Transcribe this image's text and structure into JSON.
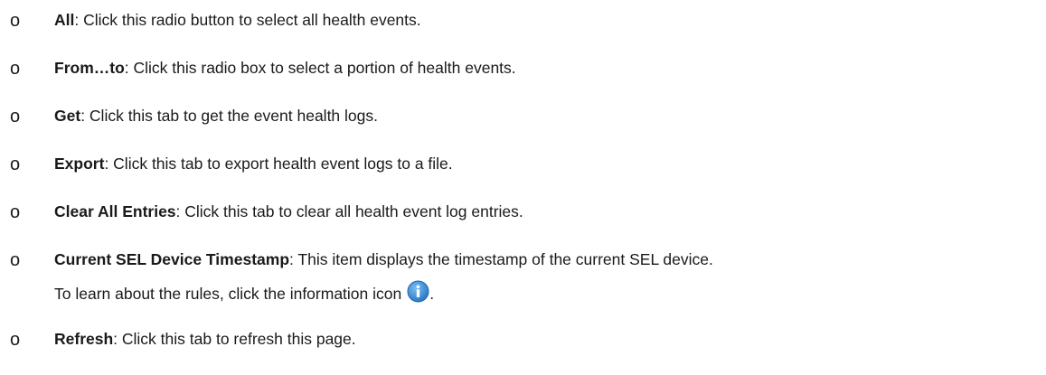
{
  "bullet_glyph": "o",
  "items": [
    {
      "term": "All",
      "desc": ": Click this radio button to select all health events."
    },
    {
      "term": "From…to",
      "desc": ": Click this radio box to select a portion of health events."
    },
    {
      "term": "Get",
      "desc": ": Click this tab to get the event health logs."
    },
    {
      "term": "Export",
      "desc": ": Click this tab to export health event logs to a file."
    },
    {
      "term": "Clear All Entries",
      "desc": ": Click this tab to clear all health event log entries."
    },
    {
      "term": "Current SEL Device Timestamp",
      "desc": ": This item displays the timestamp of the current SEL device.",
      "continuation": "To learn about the rules, click the information icon",
      "continuation_end": "."
    },
    {
      "term": "Refresh",
      "desc": ": Click this tab to refresh this page."
    }
  ],
  "icon": "info-icon",
  "colors": {
    "info_icon": "#3b8fd6"
  }
}
